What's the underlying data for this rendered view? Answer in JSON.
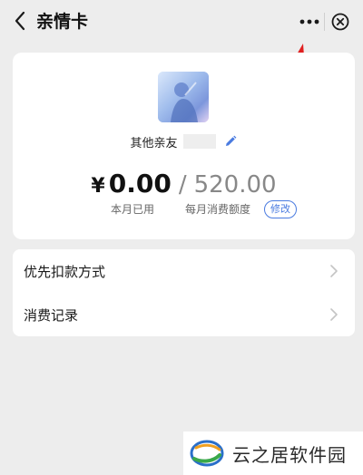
{
  "header": {
    "title": "亲情卡",
    "back_icon": "chevron-left-icon",
    "more_icon": "more-dots-icon",
    "close_icon": "close-circle-icon"
  },
  "card": {
    "member_label": "其他亲友",
    "member_name": "",
    "currency_symbol": "¥",
    "spent_amount": "0.00",
    "separator": "/",
    "monthly_limit": "520.00",
    "spent_caption": "本月已用",
    "limit_caption": "每月消费额度",
    "modify_label": "修改"
  },
  "menu": {
    "items": [
      {
        "label": "优先扣款方式"
      },
      {
        "label": "消费记录"
      }
    ]
  },
  "watermark": {
    "text": "云之居软件园"
  },
  "colors": {
    "accent": "#4a7be0",
    "annotation_arrow": "#e02020",
    "background": "#ededed"
  }
}
